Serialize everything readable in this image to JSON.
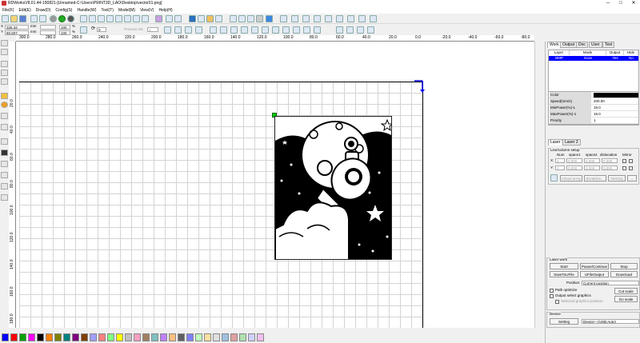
{
  "window": {
    "title": "RDWorksV8.01.44-190821-[Unnamed-C:\\Users\\PRINT3D_LAO\\Desktop\\vector01.png]",
    "minimize": "─",
    "maximize": "□",
    "close": "✕"
  },
  "menu": [
    "File(F)",
    "Edit(E)",
    "Draw(D)",
    "Config(S)",
    "Handle(W)",
    "Tool(T)",
    "Model(M)",
    "View(V)",
    "Help(H)"
  ],
  "toolbar2": {
    "x": "326.34",
    "y": "80.607",
    "xunit": "mm",
    "yunit": "mm",
    "w": "100",
    "h": "100",
    "pct1": "%",
    "pct2": "%",
    "angle": "0",
    "process_no": "Process No:",
    "process_val": "1"
  },
  "hruler": [
    "300.0",
    "280.0",
    "260.0",
    "240.0",
    "220.0",
    "200.0",
    "180.0",
    "160.0",
    "140.0",
    "120.0",
    "100.0",
    "80.0",
    "60.0",
    "40.0",
    "20.0",
    "0.0",
    "-20.0",
    "-40.0",
    "-60.0",
    "-80.0"
  ],
  "vruler": [
    "20.0",
    "40.0",
    "60.0",
    "80.0",
    "100.0",
    "120.0",
    "140.0",
    "160.0",
    "180.0"
  ],
  "panel": {
    "tabs": [
      "Work",
      "Output",
      "Doc",
      "User",
      "Test"
    ],
    "layer_headers": [
      "Layer",
      "Mode",
      "Output",
      "Hide"
    ],
    "layer_row": {
      "layer": "BMP",
      "mode": "Scan",
      "output": "Yes",
      "hide": "No"
    },
    "props": [
      {
        "k": "Color",
        "v": ""
      },
      {
        "k": "Speed(mm/s)",
        "v": "200.00"
      },
      {
        "k": "MinPower(%)-1",
        "v": "18.0"
      },
      {
        "k": "MaxPower(%)-1",
        "v": "18.0"
      },
      {
        "k": "Priority",
        "v": "1"
      }
    ],
    "laser_tabs": [
      "Laser 1",
      "Laser 2"
    ],
    "array_title": "Line/column setup",
    "array_headers": [
      "Num",
      "space1",
      "space2",
      "dislocation",
      "Mirror"
    ],
    "array_x": {
      "label": "X:",
      "num": "1",
      "s1": "0.000",
      "s2": "0.000",
      "dis": "0.000"
    },
    "array_y": {
      "label": "Y:",
      "num": "1",
      "s1": "0.000",
      "s2": "0.000",
      "dis": "0.000"
    },
    "array_buttons": [
      "Virtual array",
      "Breakline...",
      "Nesting",
      "..."
    ],
    "laser_work": "Laser work",
    "work_buttons": [
      "Start",
      "Pause/Continue",
      "Stop",
      "SaveToUFile",
      "UFileOutput",
      "Download"
    ],
    "position_label": "Position:",
    "position_value": "Current position",
    "path_optimize": "Path optimize",
    "output_selected": "Output select graphics",
    "selected_graphics_position": "Selected graphics position",
    "cut_scale": "Cut scale",
    "go_scale": "Go scale",
    "device_label": "Device",
    "setting": "Setting",
    "device_value": "Device---(USB:Auto)"
  },
  "palette": [
    "#0000ff",
    "#ff0000",
    "#00a000",
    "#ff00ff",
    "#000000",
    "#ff8000",
    "#808000",
    "#008080",
    "#800080",
    "#804000",
    "#a0a0ff",
    "#ff8080",
    "#80ff80",
    "#ffff00",
    "#c0c0c0",
    "#ffa0c0",
    "#a08060",
    "#80c0c0",
    "#c080ff",
    "#ffc080",
    "#606060",
    "#8080ff",
    "#c0ffc0",
    "#ffe0a0",
    "#e0e0e0",
    "#a0c0e0",
    "#e0a0a0",
    "#b0e0b0",
    "#d0d0ff",
    "#f0c0f0"
  ]
}
